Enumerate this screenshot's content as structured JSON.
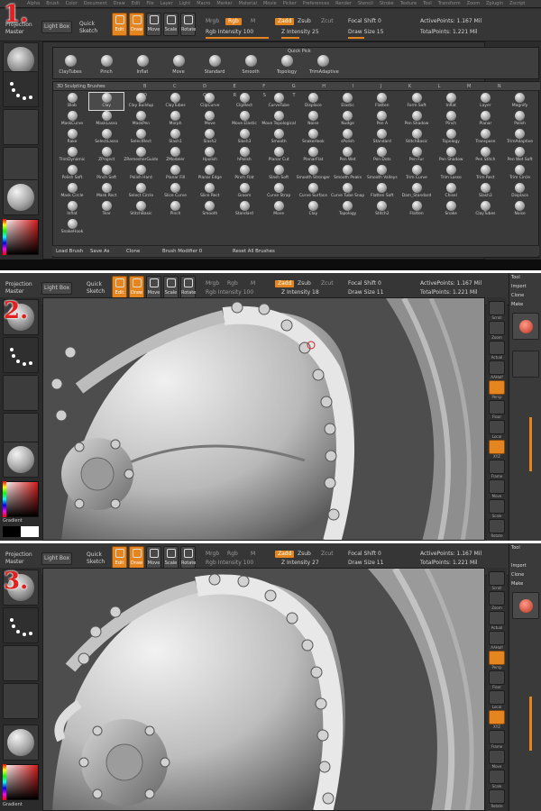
{
  "steps": [
    "1.",
    "2.",
    "3."
  ],
  "menu": [
    "Alpha",
    "Brush",
    "Color",
    "Document",
    "Draw",
    "Edit",
    "File",
    "Layer",
    "Light",
    "Macro",
    "Marker",
    "Material",
    "Movie",
    "Picker",
    "Preferences",
    "Render",
    "Stencil",
    "Stroke",
    "Texture",
    "Tool",
    "Transform",
    "Zoom",
    "Zplugin",
    "Zscript"
  ],
  "toolbar": {
    "projection_master_top": "Projection",
    "projection_master_bottom": "Master",
    "lightbox": "Light Box",
    "quick_sketch_top": "Quick",
    "quick_sketch_bottom": "Sketch",
    "edit": "Edit",
    "draw": "Draw",
    "move": "Move",
    "scale": "Scale",
    "rotate": "Rotate",
    "mrgb": "Mrgb",
    "rgb": "Rgb",
    "m": "M",
    "zadd": "Zadd",
    "zsub": "Zsub",
    "zcut": "Zcut",
    "focal_shift": "Focal Shift 0",
    "active_points": "ActivePoints: 1.167 Mil",
    "total_points": "TotalPoints: 1.221 Mil"
  },
  "panels": [
    {
      "rgb_intensity": "Rgb Intensity 100",
      "z_intensity": "Z Intensity 25",
      "draw_size": "Draw Size 15"
    },
    {
      "rgb_intensity": "Rgb Intensity 100",
      "z_intensity": "Z Intensity 18",
      "draw_size": "Draw Size 11"
    },
    {
      "rgb_intensity": "Rgb Intensity 100",
      "z_intensity": "Z Intensity 27",
      "draw_size": "Draw Size 11"
    }
  ],
  "left": {
    "gradient": "Gradient"
  },
  "quickpick": {
    "title": "Quick Pick",
    "items": [
      "ClayTubes",
      "Pinch",
      "Inflat",
      "Move",
      "Standard",
      "Smooth",
      "Topology",
      "TrimAdaptive"
    ]
  },
  "brushes": {
    "header": "3D Sculpting Brushes",
    "letters": "B C D E F G H I J K L M N O P Q R S T",
    "items": [
      "Blob",
      "Clay",
      "Clay Buildup",
      "ClayTubes",
      "ClipCurve",
      "ClipRect",
      "CurveTube",
      "Displace",
      "Elastic",
      "Flatten",
      "Form Soft",
      "Inflat",
      "Layer",
      "Magnify",
      "MaskCurve",
      "MaskLasso",
      "MaskPen",
      "Morph",
      "Move",
      "Move Elastic",
      "Move Topological",
      "Noise",
      "Nudge",
      "Pen A",
      "Pen Shadow",
      "Pinch",
      "Planar",
      "Polish",
      "Rake",
      "SelectLasso",
      "SelectRect",
      "Slash1",
      "Slash2",
      "Slash3",
      "Smooth",
      "SnakeHook",
      "sPolish",
      "Standard",
      "StitchBasic",
      "Topology",
      "Transpose",
      "TrimAdaptive",
      "TrimDynamic",
      "ZProject",
      "ZRemesherGuides",
      "ZModeler",
      "Hpolish",
      "hPolish",
      "Planar Cut",
      "PlanarFlat",
      "Pen Wet",
      "Pen Dots",
      "Pen Fur",
      "Pen Shadow",
      "Pen Stitch",
      "Pen Wet Soft",
      "Polish Soft",
      "Pinch Soft",
      "Polish Hard",
      "Planar Fill",
      "Planar Edge",
      "Pinch Flat",
      "Slash Soft",
      "Smooth Stronger",
      "Smooth Peaks",
      "Smooth Valleys",
      "Trim Curve",
      "Trim Lasso",
      "Trim Rect",
      "Trim Circle",
      "Mask Circle",
      "Mask Rect",
      "Select Circle",
      "Slice Curve",
      "Slice Rect",
      "Groom",
      "Curve Strap",
      "Curve Surface",
      "Curve Tube Snap",
      "Flatten Soft",
      "Dam_Standard",
      "Chisel",
      "Slash3",
      "Displace",
      "Inflat",
      "Tear",
      "StitchBasic",
      "Pinch",
      "Smooth",
      "Standard",
      "Move",
      "Clay",
      "Topology",
      "Stitch2",
      "Flatten",
      "Snake",
      "ClayTubes",
      "Noise",
      "SnakeHook"
    ]
  },
  "bottombar": {
    "load": "Load Brush",
    "save": "Save As",
    "clone": "Clone",
    "modifier": "Brush Modifier 0",
    "reset": "Reset All Brushes"
  },
  "rightshelf": [
    "Scroll",
    "Zoom",
    "Actual",
    "AAHalf",
    "Persp",
    "Floor",
    "Local",
    "XYZ",
    "Frame",
    "Move",
    "Scale",
    "Rotate"
  ],
  "toolpanel": {
    "title": "Tool",
    "import": "Import",
    "clone": "Clone",
    "make": "Make"
  }
}
